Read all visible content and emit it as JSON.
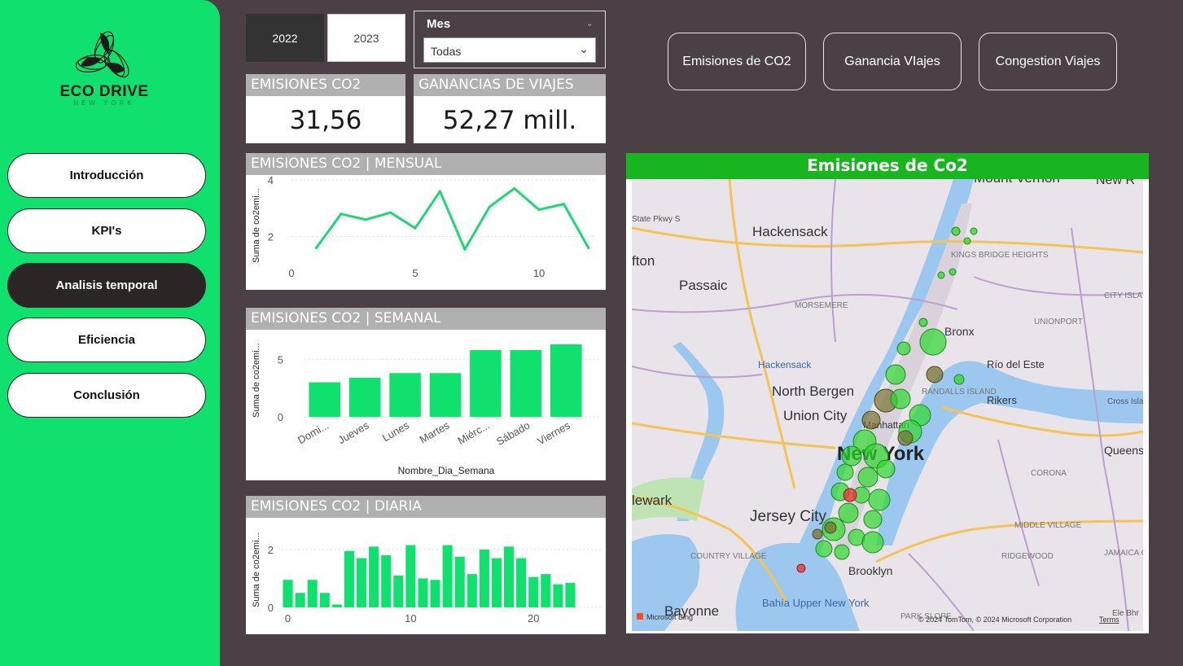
{
  "sidebar": {
    "logo_title": "ECO DRIVE",
    "logo_subtitle": "NEW YORK",
    "items": [
      {
        "label": "Introducción",
        "active": false
      },
      {
        "label": "KPI's",
        "active": false
      },
      {
        "label": "Analisis temporal",
        "active": true
      },
      {
        "label": "Eficiencia",
        "active": false
      },
      {
        "label": "Conclusión",
        "active": false
      }
    ]
  },
  "filters": {
    "years": [
      {
        "label": "2022",
        "selected": true
      },
      {
        "label": "2023",
        "selected": false
      }
    ],
    "mes_title": "Mes",
    "mes_value": "Todas"
  },
  "kpis": {
    "emisiones_title": "EMISIONES CO2",
    "emisiones_value": "31,56",
    "ganancias_title": "GANANCIAS DE VIAJES",
    "ganancias_value": "52,27 mill."
  },
  "page_buttons": [
    "Emisiones de CO2",
    "Ganancia VIajes",
    "Congestion Viajes"
  ],
  "charts": {
    "mensual_title": "EMISIONES CO2 | MENSUAL",
    "semanal_title": "EMISIONES CO2 | SEMANAL",
    "diaria_title": "EMISIONES CO2 | DIARIA",
    "ylabel": "Suma de co2emi...",
    "semanal_xlabel": "Nombre_Dia_Semana"
  },
  "chart_data": [
    {
      "type": "line",
      "title": "EMISIONES CO2 | MENSUAL",
      "ylabel": "Suma de co2emi...",
      "x": [
        1,
        2,
        3,
        4,
        5,
        6,
        7,
        8,
        9,
        10,
        11,
        12
      ],
      "values": [
        1.6,
        2.8,
        2.6,
        2.85,
        2.3,
        3.6,
        1.55,
        3.05,
        3.7,
        2.95,
        3.15,
        1.6
      ],
      "xticks": [
        0,
        5,
        10
      ],
      "yticks": [
        2,
        4
      ],
      "xlim": [
        0,
        12.3
      ],
      "ylim": [
        1.1,
        4.0
      ],
      "color": "#20d777"
    },
    {
      "type": "bar",
      "title": "EMISIONES CO2 | SEMANAL",
      "ylabel": "Suma de co2emi...",
      "xlabel": "Nombre_Dia_Semana",
      "categories": [
        "Domi...",
        "Jueves",
        "Lunes",
        "Martes",
        "Miérc...",
        "Sábado",
        "Viernes"
      ],
      "values": [
        3.0,
        3.4,
        3.8,
        3.8,
        5.8,
        5.8,
        6.3
      ],
      "yticks": [
        0,
        5
      ],
      "ylim": [
        0,
        7
      ],
      "color": "#10e06e"
    },
    {
      "type": "bar",
      "title": "EMISIONES CO2 | DIARIA",
      "ylabel": "Suma de co2emi...",
      "x": [
        0,
        1,
        2,
        3,
        4,
        5,
        6,
        7,
        8,
        9,
        10,
        11,
        12,
        13,
        14,
        15,
        16,
        17,
        18,
        19,
        20,
        21,
        22,
        23
      ],
      "values": [
        0.95,
        0.5,
        0.95,
        0.5,
        0.1,
        1.95,
        1.7,
        2.1,
        1.8,
        1.1,
        2.15,
        1.0,
        0.95,
        2.15,
        1.75,
        1.15,
        2.0,
        1.7,
        2.1,
        1.7,
        1.05,
        1.15,
        0.8,
        0.85
      ],
      "xticks": [
        0,
        10,
        20
      ],
      "yticks": [
        0,
        2
      ],
      "ylim": [
        0,
        2.7
      ],
      "color": "#10e06e"
    }
  ],
  "map": {
    "title": "Emisiones de Co2",
    "labels": {
      "hackensack": "Hackensack",
      "passaic": "Passaic",
      "fton": "fton",
      "north_bergen": "North Bergen",
      "union_city": "Union City",
      "new_york": "New York",
      "jersey_city": "Jersey City",
      "bayonne": "Bayonne",
      "brooklyn": "Brooklyn",
      "queens": "Queens",
      "bronx": "Bronx",
      "newark": "lewark",
      "mount_vernon": "Mount Vernon",
      "new_r": "New R",
      "rio_del_este": "Río del Este",
      "rikers": "Rikers",
      "manhattan": "Manhattan",
      "hackensack_small": "Hackensack",
      "morsemere": "MORSEMERE",
      "kings_bridge": "KINGS BRIDGE HEIGHTS",
      "unionport": "UNIONPORT",
      "city_isla": "CITY ISLA",
      "randalls": "RANDALLS ISLAND",
      "corona": "CORONA",
      "middle_village": "MIDDLE VILLAGE",
      "jamaica_center": "JAMAICA CENTER",
      "ridgewood": "RIDGEWOOD",
      "country_village": "COUNTRY VILLAGE",
      "park_slope": "PARK SLOPE",
      "bahia": "Bahía Upper New York",
      "state_pkwy": "State Pkwy S",
      "cross_isla": "Cross Isla",
      "elbe": "Ele Bhr",
      "attribution": "© 2024 TomTom, © 2024 Microsoft Corporation",
      "terms": "Terms",
      "ms_bing": "Microsoft Bing"
    },
    "colors": {
      "low": "#2ed82e",
      "mid": "#7a7030",
      "high": "#e83838"
    }
  }
}
